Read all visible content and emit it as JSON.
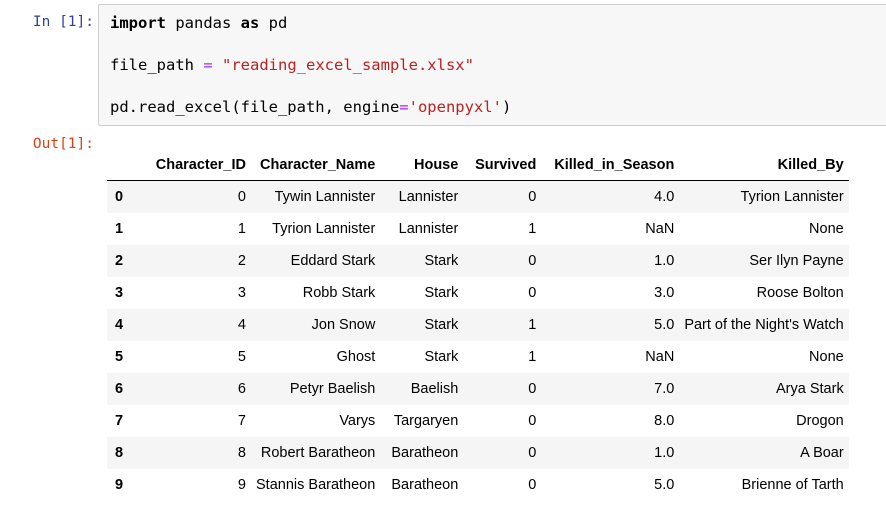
{
  "notebook": {
    "in_prompt": "In [1]:",
    "out_prompt": "Out[1]:"
  },
  "code": {
    "line1": {
      "kw1": "import",
      "mid": " pandas ",
      "kw2": "as",
      "end": " pd"
    },
    "line2": {
      "var": "file_path ",
      "op": "=",
      "str": " \"reading_excel_sample.xlsx\""
    },
    "line3": {
      "pre": "pd.read_excel(file_path, engine",
      "op": "=",
      "str": "'openpyxl'",
      "post": ")"
    }
  },
  "table": {
    "columns": [
      "",
      "Character_ID",
      "Character_Name",
      "House",
      "Survived",
      "Killed_in_Season",
      "Killed_By"
    ],
    "rows": [
      [
        "0",
        "0",
        "Tywin Lannister",
        "Lannister",
        "0",
        "4.0",
        "Tyrion Lannister"
      ],
      [
        "1",
        "1",
        "Tyrion Lannister",
        "Lannister",
        "1",
        "NaN",
        "None"
      ],
      [
        "2",
        "2",
        "Eddard Stark",
        "Stark",
        "0",
        "1.0",
        "Ser Ilyn Payne"
      ],
      [
        "3",
        "3",
        "Robb Stark",
        "Stark",
        "0",
        "3.0",
        "Roose Bolton"
      ],
      [
        "4",
        "4",
        "Jon Snow",
        "Stark",
        "1",
        "5.0",
        "Part of the Night's Watch"
      ],
      [
        "5",
        "5",
        "Ghost",
        "Stark",
        "1",
        "NaN",
        "None"
      ],
      [
        "6",
        "6",
        "Petyr Baelish",
        "Baelish",
        "0",
        "7.0",
        "Arya Stark"
      ],
      [
        "7",
        "7",
        "Varys",
        "Targaryen",
        "0",
        "8.0",
        "Drogon"
      ],
      [
        "8",
        "8",
        "Robert Baratheon",
        "Baratheon",
        "0",
        "1.0",
        "A Boar"
      ],
      [
        "9",
        "9",
        "Stannis Baratheon",
        "Baratheon",
        "0",
        "5.0",
        "Brienne of Tarth"
      ]
    ]
  }
}
